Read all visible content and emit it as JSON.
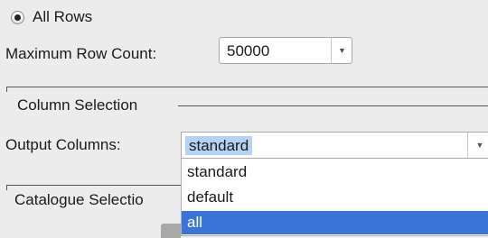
{
  "rows": {
    "option_label": "All Rows",
    "selected": true
  },
  "max_rows": {
    "label": "Maximum Row Count:",
    "value": "50000"
  },
  "column_selection": {
    "title": "Column Selection",
    "output_label": "Output Columns:",
    "selected": "standard",
    "options": [
      "standard",
      "default",
      "all"
    ],
    "highlighted_option": "all"
  },
  "catalogue_selection": {
    "title": "Catalogue Selectio"
  },
  "colors": {
    "selection_blue": "#3b74d6",
    "text_highlight": "#b5d1f3"
  },
  "icons": {
    "dropdown": "chevron-down-icon",
    "radio": "radio-selected-icon"
  }
}
